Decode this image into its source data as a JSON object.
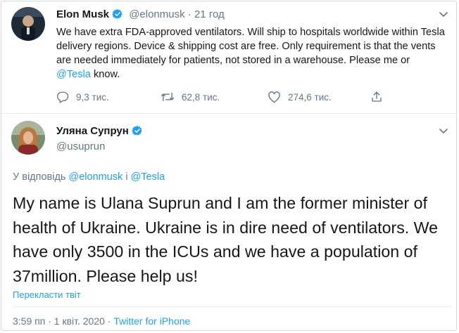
{
  "tweet1": {
    "author_name": "Elon Musk",
    "author_handle": "@elonmusk",
    "separator": "·",
    "time": "21 год",
    "text_before": "We have extra FDA-approved ventilators. Will ship to hospitals worldwide within Tesla delivery regions. Device & shipping cost are free. Only requirement is that the vents are needed immediately for patients, not stored in a warehouse. Please me or ",
    "mention": "@Tesla",
    "text_after": " know.",
    "replies": "9,3 тис.",
    "retweets": "62,8 тис.",
    "likes": "274,6 тис."
  },
  "tweet2": {
    "author_name": "Уляна Супрун",
    "author_handle": "@usuprun",
    "reply_prefix": "У відповідь ",
    "reply_to_1": "@elonmusk",
    "reply_conj": " і ",
    "reply_to_2": "@Tesla",
    "text": "My name is Ulana Suprun and I am the former minister of health of Ukraine. Ukraine is in dire need of ventilators. We have only 3500 in the ICUs and we have a population of  37million. Please help us!",
    "translate_label": "Перекласти твіт",
    "time": "3:59 пп",
    "date": "1 квіт. 2020",
    "dot": "·",
    "source": "Twitter for iPhone"
  },
  "colors": {
    "accent": "#1da1f2",
    "secondary_text": "#657786",
    "primary_text": "#14171a",
    "divider": "#e6ecf0"
  },
  "icons": [
    "verified-badge-icon",
    "chevron-down-icon",
    "reply-icon",
    "retweet-icon",
    "like-icon",
    "share-icon"
  ]
}
